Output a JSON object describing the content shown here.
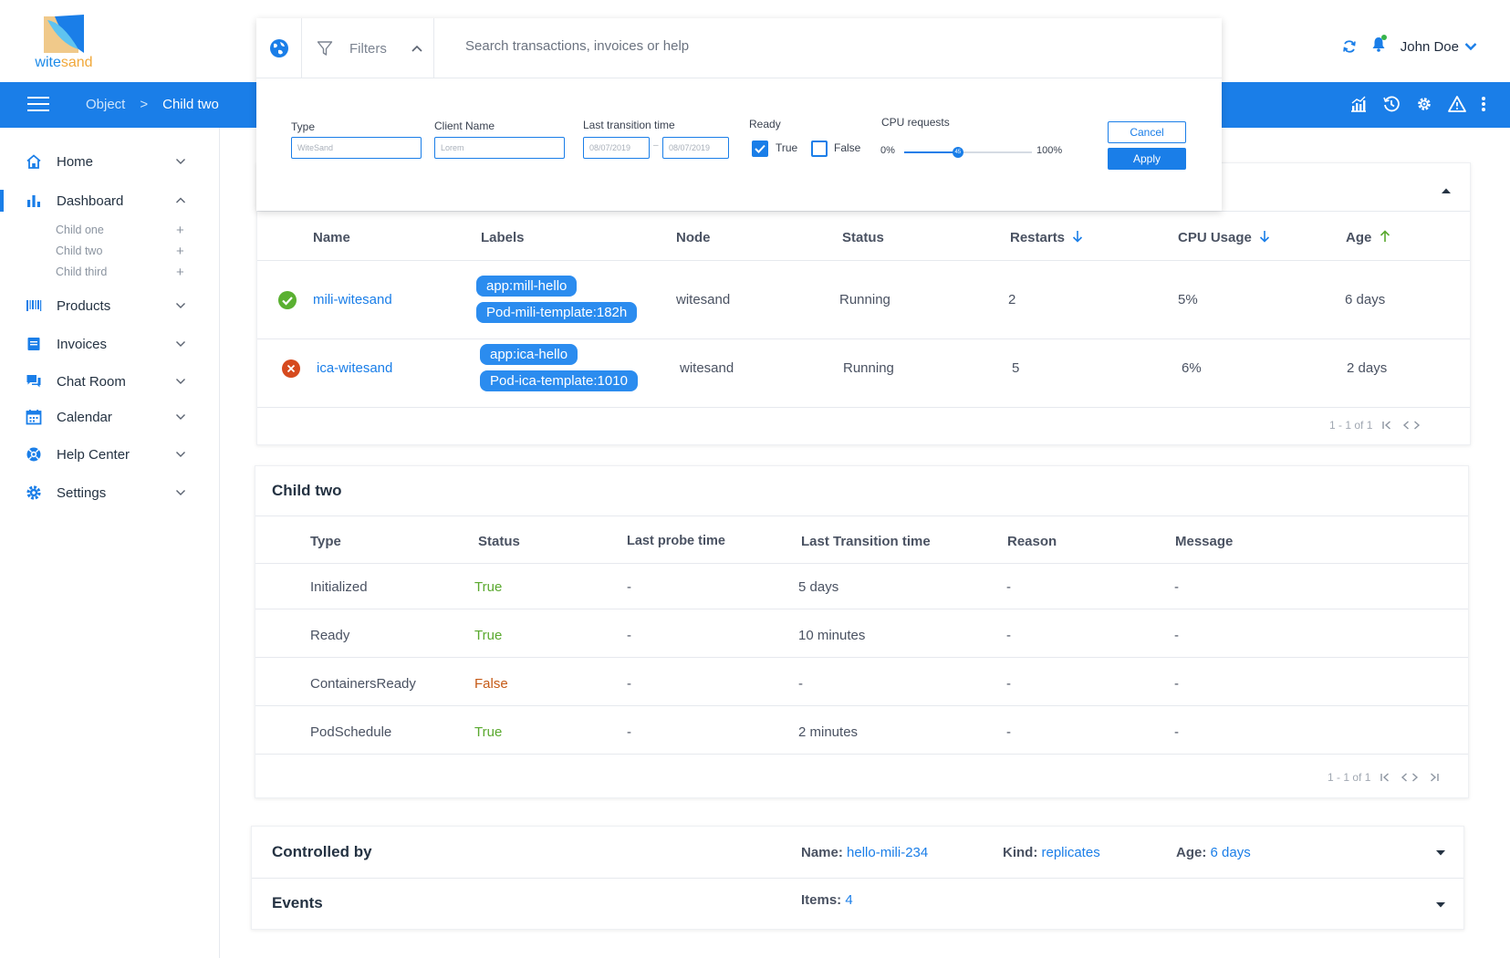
{
  "brand": {
    "name_part1": "wite",
    "name_part2": "sand"
  },
  "header": {
    "user_name": "John Doe"
  },
  "breadcrumb": {
    "items": [
      "Object",
      ">",
      "Child two"
    ]
  },
  "sidebar": {
    "items": [
      {
        "label": "Home",
        "icon": "home-icon"
      },
      {
        "label": "Dashboard",
        "icon": "bar-chart-icon"
      },
      {
        "label": "Products",
        "icon": "barcode-icon"
      },
      {
        "label": "Invoices",
        "icon": "invoice-icon"
      },
      {
        "label": "Chat Room",
        "icon": "chat-icon"
      },
      {
        "label": "Calendar",
        "icon": "calendar-icon"
      },
      {
        "label": "Help Center",
        "icon": "help-icon"
      },
      {
        "label": "Settings",
        "icon": "gear-icon"
      }
    ],
    "dashboard_children": [
      "Child one",
      "Child two",
      "Child third"
    ]
  },
  "filter": {
    "filters_label": "Filters",
    "search_placeholder": "Search transactions, invoices or help",
    "type_label": "Type",
    "type_value": "WiteSand",
    "client_label": "Client Name",
    "client_value": "Lorem",
    "transition_label": "Last transition time",
    "date_from": "08/07/2019",
    "date_sep": "–",
    "date_to": "08/07/2019",
    "ready_label": "Ready",
    "ready_true": "True",
    "ready_false": "False",
    "ready_true_checked": true,
    "ready_false_checked": false,
    "cpu_label": "CPU requests",
    "cpu_min": "0%",
    "cpu_max": "100%",
    "cpu_value_label": "45",
    "cpu_value": 0.42,
    "cancel": "Cancel",
    "apply": "Apply"
  },
  "pods": {
    "columns": [
      "Name",
      "Labels",
      "Node",
      "Status",
      "Restarts",
      "CPU Usage",
      "Age"
    ],
    "rows": [
      {
        "ok": true,
        "name": "mili-witesand",
        "labels": [
          "app:mill-hello",
          "Pod-mili-template:182h"
        ],
        "node": "witesand",
        "status": "Running",
        "restarts": "2",
        "cpu": "5%",
        "age": "6 days"
      },
      {
        "ok": false,
        "name": "ica-witesand",
        "labels": [
          "app:ica-hello",
          "Pod-ica-template:1010"
        ],
        "node": "witesand",
        "status": "Running",
        "restarts": "5",
        "cpu": "6%",
        "age": "2 days"
      }
    ],
    "pager": "1 - 1 of 1"
  },
  "conditions": {
    "title": "Child two",
    "columns": [
      "Type",
      "Status",
      "Last probe time",
      "Last Transition time",
      "Reason",
      "Message"
    ],
    "rows": [
      {
        "type": "Initialized",
        "status": "True",
        "probe": "-",
        "transition": "5 days",
        "reason": "-",
        "message": "-"
      },
      {
        "type": "Ready",
        "status": "True",
        "probe": "-",
        "transition": "10 minutes",
        "reason": "-",
        "message": "-"
      },
      {
        "type": "ContainersReady",
        "status": "False",
        "probe": "-",
        "transition": "-",
        "reason": "-",
        "message": "-"
      },
      {
        "type": "PodSchedule",
        "status": "True",
        "probe": "-",
        "transition": "2 minutes",
        "reason": "-",
        "message": "-"
      }
    ],
    "pager": "1 - 1 of 1"
  },
  "controlled": {
    "title": "Controlled by",
    "name_label": "Name:",
    "name_value": "hello-mili-234",
    "kind_label": "Kind:",
    "kind_value": "replicates",
    "age_label": "Age:",
    "age_value": "6 days"
  },
  "events": {
    "title": "Events",
    "items_label": "Items:",
    "items_value": "4"
  },
  "colors": {
    "primary": "#1a7ee8",
    "true": "#5aa92f",
    "false": "#c55a16",
    "ok": "#5ab031",
    "error": "#d64a1e"
  }
}
